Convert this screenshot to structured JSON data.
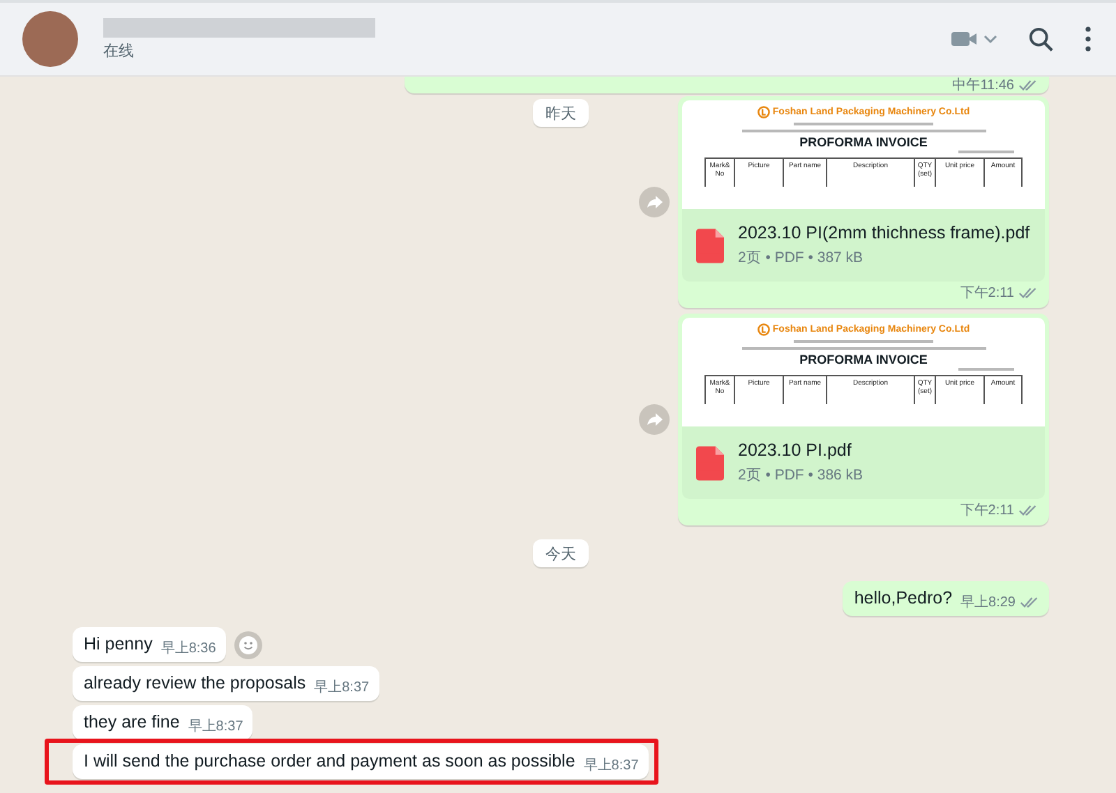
{
  "header": {
    "status": "在线"
  },
  "messages": [
    {
      "kind": "cut",
      "outgoing": true,
      "time": "中午11:46",
      "delivered": true
    },
    {
      "kind": "date",
      "label": "昨天"
    },
    {
      "kind": "document",
      "outgoing": true,
      "company": "Foshan Land Packaging Machinery Co.Ltd",
      "doc_title": "PROFORMA INVOICE",
      "columns": [
        "Mark& No",
        "Picture",
        "Part name",
        "Description",
        "QTY (set)",
        "Unit price",
        "Amount"
      ],
      "file_name": "2023.10 PI(2mm thichness frame).pdf",
      "details": "2页 • PDF • 387 kB",
      "time": "下午2:11",
      "delivered": true
    },
    {
      "kind": "document",
      "outgoing": true,
      "company": "Foshan Land Packaging Machinery Co.Ltd",
      "doc_title": "PROFORMA INVOICE",
      "columns": [
        "Mark& No",
        "Picture",
        "Part name",
        "Description",
        "QTY (set)",
        "Unit price",
        "Amount"
      ],
      "file_name": "2023.10 PI.pdf",
      "details": "2页 • PDF • 386 kB",
      "time": "下午2:11",
      "delivered": true
    },
    {
      "kind": "date",
      "label": "今天"
    },
    {
      "kind": "text",
      "outgoing": true,
      "text": "hello,Pedro?",
      "time": "早上8:29",
      "delivered": true,
      "emoji_button": false,
      "highlighted": false
    },
    {
      "kind": "text",
      "outgoing": false,
      "text": "Hi penny",
      "time": "早上8:36",
      "delivered": false,
      "emoji_button": true,
      "highlighted": false
    },
    {
      "kind": "text",
      "outgoing": false,
      "text": "already review the proposals",
      "time": "早上8:37",
      "delivered": false,
      "emoji_button": false,
      "highlighted": false
    },
    {
      "kind": "text",
      "outgoing": false,
      "text": "they are fine",
      "time": "早上8:37",
      "delivered": false,
      "emoji_button": false,
      "highlighted": false
    },
    {
      "kind": "text",
      "outgoing": false,
      "text": "I will send the purchase order and payment as soon as possible",
      "time": "早上8:37",
      "delivered": false,
      "emoji_button": false,
      "highlighted": true
    }
  ]
}
